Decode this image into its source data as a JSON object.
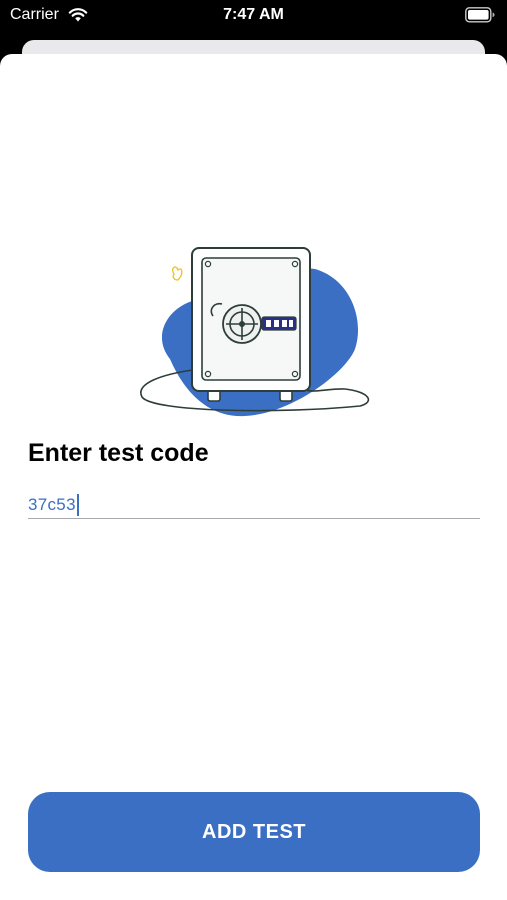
{
  "status_bar": {
    "carrier": "Carrier",
    "time": "7:47 AM",
    "wifi_icon": "wifi-icon",
    "battery_icon": "battery-icon"
  },
  "illustration": {
    "icon": "safe-illustration",
    "accent_color": "#3a6fc4"
  },
  "form": {
    "title": "Enter test code",
    "code_value": "37c53"
  },
  "actions": {
    "add_test_label": "ADD TEST"
  },
  "colors": {
    "accent": "#3a6fc4",
    "background": "#ffffff"
  }
}
